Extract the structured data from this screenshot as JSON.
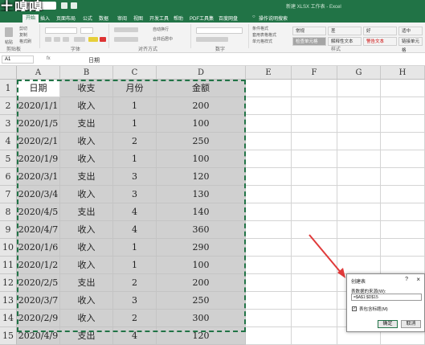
{
  "watermark": "土嗅嗅",
  "title_bar": {
    "search_hint": "搜索",
    "title": "新建 XLSX 工作表 - Excel"
  },
  "ribbon_tabs": [
    "开始",
    "插入",
    "页面布局",
    "公式",
    "数据",
    "审阅",
    "视图",
    "开发工具",
    "帮助",
    "PDF工具集",
    "百度网盘",
    "操作说明搜索"
  ],
  "ribbon_groups": {
    "clipboard": "剪贴板",
    "font": "字体",
    "alignment": "对齐方式",
    "number": "数字",
    "styles": "样式"
  },
  "ribbon_buttons": {
    "paste": "粘贴",
    "cut": "剪切",
    "copy": "复制",
    "format_painter": "格式刷",
    "wrap": "自动换行",
    "merge": "合并后居中",
    "cond_format": "条件格式",
    "table_format": "套用表格格式",
    "cell_styles": "单元格样式"
  },
  "styles": [
    {
      "label": "常规",
      "bg": "#ffffff"
    },
    {
      "label": "差",
      "bg": "#ffffff"
    },
    {
      "label": "好",
      "bg": "#ffffff"
    },
    {
      "label": "适中",
      "bg": "#ffffff"
    },
    {
      "label": "检查单元格",
      "bg": "#a5a5a5"
    },
    {
      "label": "解释性文本",
      "bg": "#ffffff"
    },
    {
      "label": "警告文本",
      "bg": "#ffffff"
    },
    {
      "label": "链接单元格",
      "bg": "#ffffff"
    }
  ],
  "formula_bar": {
    "name_box": "A1",
    "fx": "fx",
    "content": "日期"
  },
  "columns": [
    "A",
    "B",
    "C",
    "D",
    "E",
    "F",
    "G",
    "H"
  ],
  "rows": [
    "1",
    "2",
    "3",
    "4",
    "5",
    "6",
    "7",
    "8",
    "9",
    "10",
    "11",
    "12",
    "13",
    "14",
    "15"
  ],
  "table": {
    "headers": [
      "日期",
      "收支",
      "月份",
      "金额"
    ],
    "rows": [
      [
        "2020/1/1",
        "收入",
        "1",
        "200"
      ],
      [
        "2020/1/5",
        "支出",
        "1",
        "100"
      ],
      [
        "2020/2/1",
        "收入",
        "2",
        "250"
      ],
      [
        "2020/1/9",
        "收入",
        "1",
        "100"
      ],
      [
        "2020/3/1",
        "支出",
        "3",
        "120"
      ],
      [
        "2020/3/4",
        "收入",
        "3",
        "130"
      ],
      [
        "2020/4/5",
        "支出",
        "4",
        "140"
      ],
      [
        "2020/4/7",
        "收入",
        "4",
        "360"
      ],
      [
        "2020/1/6",
        "收入",
        "1",
        "290"
      ],
      [
        "2020/1/2",
        "收入",
        "1",
        "100"
      ],
      [
        "2020/2/5",
        "支出",
        "2",
        "200"
      ],
      [
        "2020/3/7",
        "收入",
        "3",
        "250"
      ],
      [
        "2020/2/9",
        "收入",
        "2",
        "300"
      ],
      [
        "2020/4/9",
        "支出",
        "4",
        "120"
      ]
    ]
  },
  "dialog": {
    "title": "创建表",
    "help": "?",
    "close": "×",
    "range_label": "表数据的来源(W):",
    "range_value": "=$A$1:$D$15",
    "checkbox_checked": true,
    "checkbox_label": "表包含标题(M)",
    "ok": "确定",
    "cancel": "取消"
  },
  "colors": {
    "excel_green": "#217346",
    "selection_gray": "#d0d0d0",
    "arrow_red": "#e03a3a"
  }
}
